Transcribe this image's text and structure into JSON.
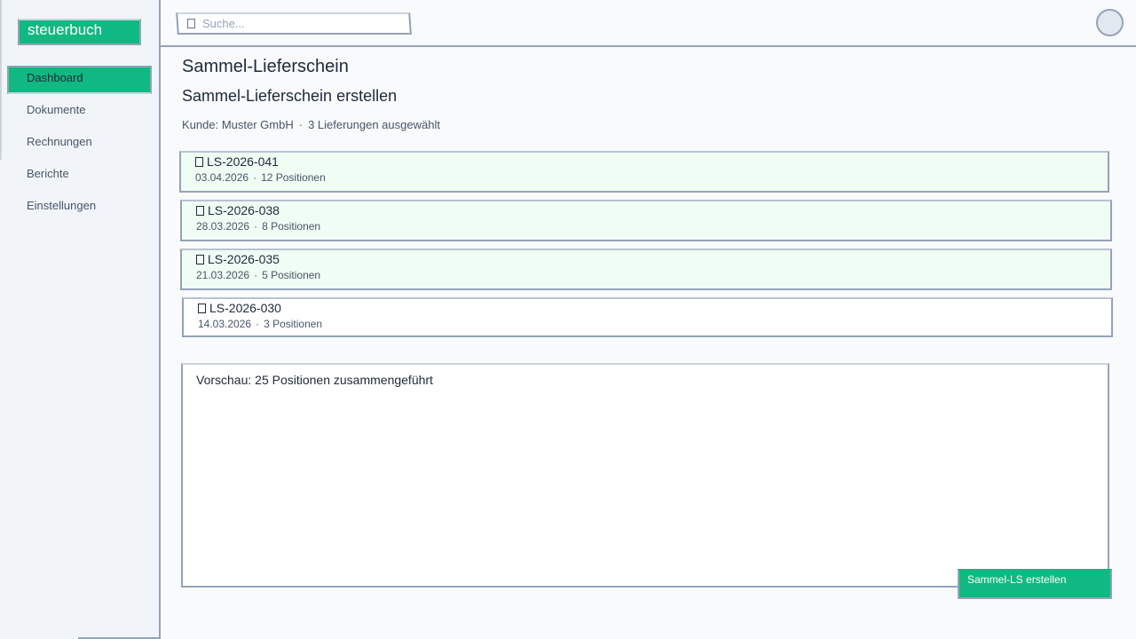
{
  "app": {
    "logo_text": "steuerbuch"
  },
  "sidebar": {
    "items": [
      {
        "label": "Dashboard",
        "active": true
      },
      {
        "label": "Dokumente",
        "active": false
      },
      {
        "label": "Rechnungen",
        "active": false
      },
      {
        "label": "Berichte",
        "active": false
      },
      {
        "label": "Einstellungen",
        "active": false
      }
    ]
  },
  "header": {
    "search_icon": "search-icon",
    "search_placeholder": "Suche...",
    "search_value": ""
  },
  "main": {
    "page_title": "Sammel-Lieferschein",
    "section_title": "Sammel-Lieferschein erstellen",
    "customer": "Kunde: Muster GmbH",
    "separator": "·",
    "selected_count": "3 Lieferungen ausgewählt",
    "deliveries": [
      {
        "number": "LS-2026-041",
        "date": "03.04.2026",
        "positions": "12 Positionen",
        "selected": true
      },
      {
        "number": "LS-2026-038",
        "date": "28.03.2026",
        "positions": "8 Positionen",
        "selected": true
      },
      {
        "number": "LS-2026-035",
        "date": "21.03.2026",
        "positions": "5 Positionen",
        "selected": true
      },
      {
        "number": "LS-2026-030",
        "date": "14.03.2026",
        "positions": "3 Positionen",
        "selected": false
      }
    ],
    "preview_text": "Vorschau: 25 Positionen zusammengeführt",
    "create_button_label": "Sammel-LS erstellen"
  },
  "colors": {
    "accent": "#10b981",
    "border": "#94a3b8",
    "selected_row_bg": "#f0fdf4",
    "background": "#f8fafc",
    "sidebar_bg": "#f1f5f9"
  }
}
